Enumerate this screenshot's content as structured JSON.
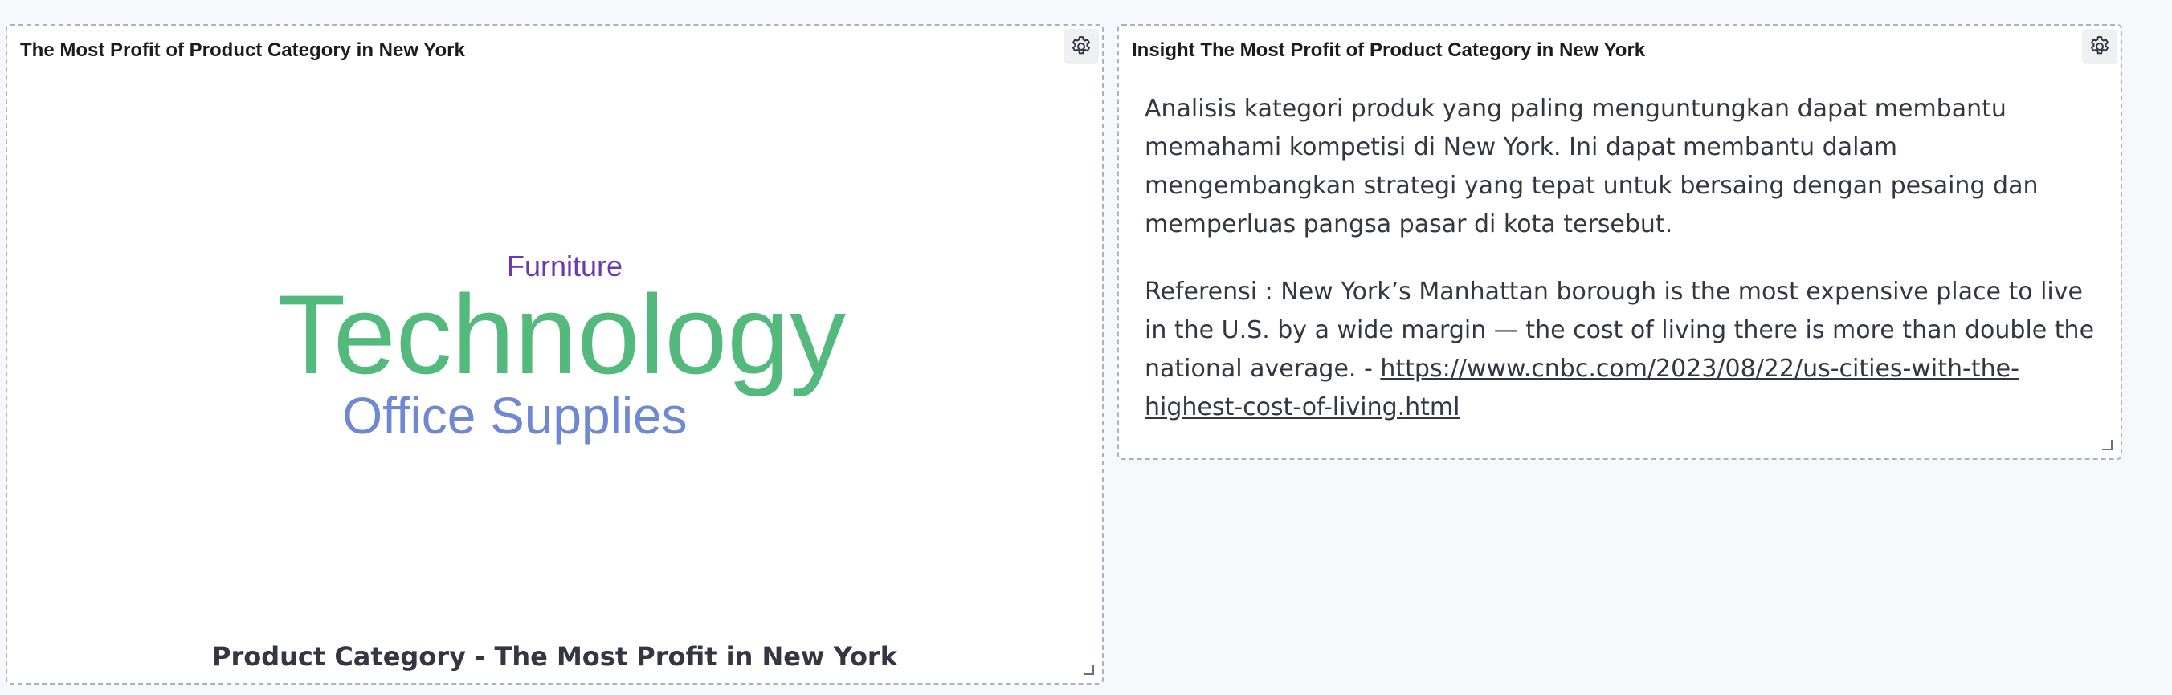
{
  "panels": {
    "left": {
      "title": "The Most Profit of Product Category in New York",
      "settings_icon": "gear-icon",
      "resize_icon": "resize-corner-icon"
    },
    "right": {
      "title": "Insight The Most Profit of Product Category in New York",
      "settings_icon": "gear-icon",
      "resize_icon": "resize-corner-icon",
      "paragraph_1": "Analisis kategori produk yang paling menguntungkan dapat membantu memahami kompetisi di New York. Ini dapat membantu dalam mengembangkan strategi yang tepat untuk bersaing dengan pesaing dan memperluas pangsa pasar di kota tersebut.",
      "paragraph_2_prefix": "Referensi : New York’s Manhattan borough is the most expensive place to live in the U.S. by a wide margin — the cost of living there is more than double the national average. - ",
      "link_text": "https://www.cnbc.com/2023/08/22/us-cities-with-the-highest-cost-of-living.html",
      "link_href": "https://www.cnbc.com/2023/08/22/us-cities-with-the-highest-cost-of-living.html"
    }
  },
  "chart_data": {
    "type": "wordcloud",
    "title": "Product Category - The Most Profit in New York",
    "words": [
      {
        "text": "Technology",
        "rank": 1,
        "color": "#54b97d"
      },
      {
        "text": "Office Supplies",
        "rank": 2,
        "color": "#6e89d2"
      },
      {
        "text": "Furniture",
        "rank": 3,
        "color": "#6c38b4"
      }
    ]
  },
  "colors": {
    "background": "#f7f8fc",
    "panel_border": "#aab1bf",
    "text_primary": "#1a1c21",
    "text_secondary": "#343741"
  }
}
